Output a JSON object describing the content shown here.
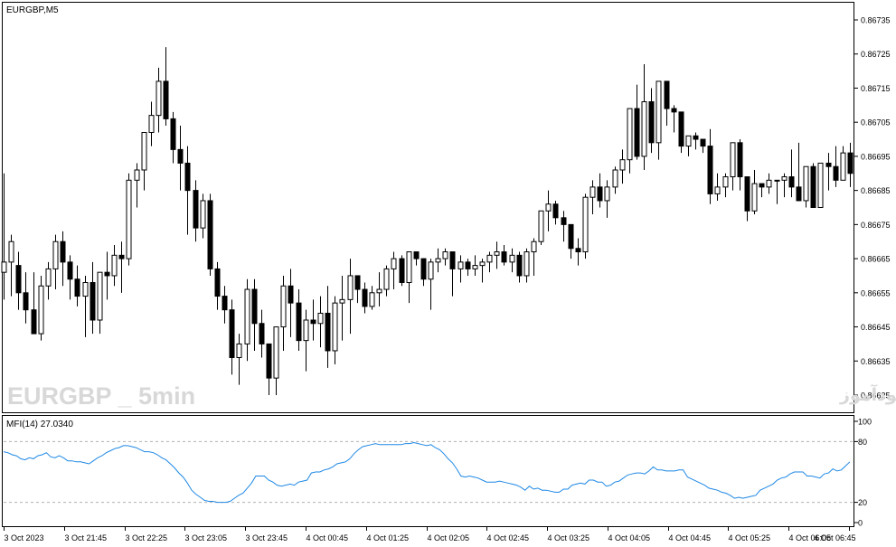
{
  "colors": {
    "background": "#ffffff",
    "foreground": "#000000",
    "bull_candle_fill": "#ffffff",
    "bear_candle_fill": "#000000",
    "mfi_line": "#1e88e5",
    "level_line": "#b0b0b0",
    "watermark": "#d8d8d8"
  },
  "main_panel": {
    "symbol_label": "EURGBP,M5",
    "watermark_left": "EURGBP _ 5min",
    "watermark_right": "انتشار در سایت سودآموز"
  },
  "indicator_panel": {
    "label": "MFI(14) 27.0340",
    "levels": [
      80,
      20
    ]
  },
  "chart_data": [
    {
      "type": "candlestick",
      "title": "EURGBP,M5",
      "ylim": [
        0.86618,
        0.86738
      ],
      "y_ticks": [
        "0.86735",
        "0.86725",
        "0.86715",
        "0.86705",
        "0.86695",
        "0.86685",
        "0.86675",
        "0.86665",
        "0.86655",
        "0.86645",
        "0.86635",
        "0.86625"
      ],
      "x_tick_labels": [
        "3 Oct 2023",
        "3 Oct 21:45",
        "3 Oct 22:25",
        "3 Oct 23:05",
        "3 Oct 23:45",
        "4 Oct 00:45",
        "4 Oct 01:25",
        "4 Oct 02:05",
        "4 Oct 02:45",
        "4 Oct 03:25",
        "4 Oct 04:05",
        "4 Oct 04:45",
        "4 Oct 05:25",
        "4 Oct 06:05",
        "4 Oct 06:45"
      ],
      "candles": [
        [
          0.86661,
          0.8669,
          0.86653,
          0.86664
        ],
        [
          0.86664,
          0.86672,
          0.86654,
          0.8667
        ],
        [
          0.86663,
          0.86667,
          0.8665,
          0.86655
        ],
        [
          0.86655,
          0.86661,
          0.86646,
          0.8665
        ],
        [
          0.8665,
          0.86661,
          0.86645,
          0.86643
        ],
        [
          0.86643,
          0.8666,
          0.86641,
          0.86657
        ],
        [
          0.86657,
          0.86664,
          0.86653,
          0.86662
        ],
        [
          0.86662,
          0.86672,
          0.86656,
          0.8667
        ],
        [
          0.8667,
          0.86673,
          0.86657,
          0.86664
        ],
        [
          0.86664,
          0.86666,
          0.86653,
          0.86659
        ],
        [
          0.86659,
          0.86663,
          0.86651,
          0.86654
        ],
        [
          0.86654,
          0.8666,
          0.86642,
          0.86658
        ],
        [
          0.86658,
          0.86664,
          0.86643,
          0.86647
        ],
        [
          0.86647,
          0.86661,
          0.86643,
          0.86661
        ],
        [
          0.86661,
          0.86667,
          0.86653,
          0.8666
        ],
        [
          0.8666,
          0.86669,
          0.86657,
          0.86666
        ],
        [
          0.86666,
          0.8667,
          0.86655,
          0.86665
        ],
        [
          0.86665,
          0.8669,
          0.86663,
          0.86688
        ],
        [
          0.86688,
          0.86693,
          0.8668,
          0.86691
        ],
        [
          0.86691,
          0.86702,
          0.86685,
          0.86702
        ],
        [
          0.86702,
          0.86711,
          0.86698,
          0.86707
        ],
        [
          0.86707,
          0.86721,
          0.86702,
          0.86717
        ],
        [
          0.86717,
          0.86727,
          0.86704,
          0.86706
        ],
        [
          0.86706,
          0.86708,
          0.86693,
          0.86697
        ],
        [
          0.86697,
          0.86704,
          0.86685,
          0.86693
        ],
        [
          0.86693,
          0.86698,
          0.86672,
          0.86685
        ],
        [
          0.86685,
          0.86688,
          0.8667,
          0.86674
        ],
        [
          0.86674,
          0.86684,
          0.86671,
          0.86682
        ],
        [
          0.86682,
          0.86684,
          0.8666,
          0.86662
        ],
        [
          0.86662,
          0.86664,
          0.8665,
          0.86654
        ],
        [
          0.86654,
          0.86657,
          0.86646,
          0.8665
        ],
        [
          0.8665,
          0.86653,
          0.86631,
          0.86636
        ],
        [
          0.86636,
          0.86643,
          0.86628,
          0.8664
        ],
        [
          0.8664,
          0.86659,
          0.86635,
          0.86656
        ],
        [
          0.86656,
          0.86659,
          0.86638,
          0.86646
        ],
        [
          0.86646,
          0.8665,
          0.86636,
          0.8664
        ],
        [
          0.8664,
          0.86637,
          0.86625,
          0.8663
        ],
        [
          0.8663,
          0.86642,
          0.86625,
          0.86645
        ],
        [
          0.86645,
          0.8666,
          0.86638,
          0.86657
        ],
        [
          0.86657,
          0.86662,
          0.86642,
          0.86652
        ],
        [
          0.86652,
          0.86656,
          0.86638,
          0.86641
        ],
        [
          0.86641,
          0.8665,
          0.86632,
          0.86647
        ],
        [
          0.86647,
          0.86653,
          0.86641,
          0.86646
        ],
        [
          0.86646,
          0.86654,
          0.86639,
          0.86649
        ],
        [
          0.86649,
          0.86657,
          0.86633,
          0.86638
        ],
        [
          0.86638,
          0.86654,
          0.86634,
          0.86652
        ],
        [
          0.86652,
          0.8666,
          0.86641,
          0.86653
        ],
        [
          0.86653,
          0.86665,
          0.86643,
          0.8666
        ],
        [
          0.8666,
          0.8666,
          0.86652,
          0.86656
        ],
        [
          0.86656,
          0.86658,
          0.86649,
          0.86651
        ],
        [
          0.86651,
          0.86657,
          0.8665,
          0.86655
        ],
        [
          0.86655,
          0.86661,
          0.86651,
          0.86656
        ],
        [
          0.86656,
          0.86663,
          0.86654,
          0.86662
        ],
        [
          0.86662,
          0.86667,
          0.86656,
          0.86665
        ],
        [
          0.86665,
          0.86666,
          0.86657,
          0.86658
        ],
        [
          0.86658,
          0.86658,
          0.86652,
          0.86667
        ],
        [
          0.86667,
          0.86666,
          0.86663,
          0.86665
        ],
        [
          0.86665,
          0.86663,
          0.86657,
          0.86659
        ],
        [
          0.86659,
          0.86665,
          0.8665,
          0.86664
        ],
        [
          0.86664,
          0.86668,
          0.86661,
          0.86665
        ],
        [
          0.86665,
          0.86668,
          0.86663,
          0.86667
        ],
        [
          0.86667,
          0.86663,
          0.86654,
          0.86662
        ],
        [
          0.86662,
          0.86666,
          0.86658,
          0.86664
        ],
        [
          0.86664,
          0.86665,
          0.8666,
          0.86662
        ],
        [
          0.86662,
          0.86666,
          0.8666,
          0.86663
        ],
        [
          0.86663,
          0.86665,
          0.86658,
          0.86664
        ],
        [
          0.86664,
          0.86667,
          0.86661,
          0.86666
        ],
        [
          0.86666,
          0.8667,
          0.86662,
          0.86667
        ],
        [
          0.86667,
          0.86669,
          0.86663,
          0.86664
        ],
        [
          0.86664,
          0.86668,
          0.86661,
          0.86666
        ],
        [
          0.86666,
          0.86667,
          0.86658,
          0.8666
        ],
        [
          0.8666,
          0.86668,
          0.86658,
          0.86667
        ],
        [
          0.86667,
          0.86671,
          0.8666,
          0.8667
        ],
        [
          0.8667,
          0.86679,
          0.86669,
          0.86679
        ],
        [
          0.86679,
          0.86685,
          0.86673,
          0.86681
        ],
        [
          0.86681,
          0.86682,
          0.86675,
          0.86677
        ],
        [
          0.86677,
          0.86679,
          0.8667,
          0.86675
        ],
        [
          0.86675,
          0.86674,
          0.86665,
          0.86668
        ],
        [
          0.86668,
          0.86671,
          0.86663,
          0.86667
        ],
        [
          0.86667,
          0.86684,
          0.86665,
          0.86683
        ],
        [
          0.86683,
          0.86688,
          0.86678,
          0.86686
        ],
        [
          0.86686,
          0.8669,
          0.8668,
          0.86682
        ],
        [
          0.86682,
          0.86688,
          0.86677,
          0.86686
        ],
        [
          0.86686,
          0.86692,
          0.86684,
          0.86691
        ],
        [
          0.86691,
          0.86697,
          0.86687,
          0.86694
        ],
        [
          0.86694,
          0.86709,
          0.8669,
          0.86709
        ],
        [
          0.86709,
          0.86716,
          0.86694,
          0.86695
        ],
        [
          0.86695,
          0.86722,
          0.86691,
          0.86711
        ],
        [
          0.86711,
          0.86715,
          0.86696,
          0.86699
        ],
        [
          0.86699,
          0.86712,
          0.86694,
          0.86717
        ],
        [
          0.86717,
          0.86716,
          0.86704,
          0.86709
        ],
        [
          0.86709,
          0.8671,
          0.86702,
          0.86708
        ],
        [
          0.86708,
          0.86707,
          0.86696,
          0.86698
        ],
        [
          0.86698,
          0.86701,
          0.86695,
          0.86701
        ],
        [
          0.86701,
          0.86702,
          0.86697,
          0.867
        ],
        [
          0.867,
          0.86699,
          0.86696,
          0.86698
        ],
        [
          0.86698,
          0.86703,
          0.86681,
          0.86684
        ],
        [
          0.86684,
          0.8669,
          0.86682,
          0.86686
        ],
        [
          0.86686,
          0.8669,
          0.86683,
          0.86689
        ],
        [
          0.86689,
          0.86699,
          0.86685,
          0.86699
        ],
        [
          0.86699,
          0.867,
          0.86685,
          0.86689
        ],
        [
          0.86689,
          0.86689,
          0.86676,
          0.86679
        ],
        [
          0.86679,
          0.86691,
          0.86678,
          0.86687
        ],
        [
          0.86687,
          0.86687,
          0.86683,
          0.86686
        ],
        [
          0.86686,
          0.8669,
          0.86684,
          0.86688
        ],
        [
          0.86688,
          0.86688,
          0.86681,
          0.86688
        ],
        [
          0.86688,
          0.8669,
          0.86683,
          0.86689
        ],
        [
          0.86689,
          0.86697,
          0.86683,
          0.86686
        ],
        [
          0.86686,
          0.86699,
          0.86682,
          0.86682
        ],
        [
          0.86682,
          0.86692,
          0.8668,
          0.86692
        ],
        [
          0.86692,
          0.86693,
          0.86681,
          0.8668
        ],
        [
          0.8668,
          0.86689,
          0.8668,
          0.86693
        ],
        [
          0.86693,
          0.86696,
          0.86685,
          0.86692
        ],
        [
          0.86692,
          0.86698,
          0.86686,
          0.86688
        ],
        [
          0.86688,
          0.86698,
          0.86688,
          0.86696
        ],
        [
          0.86696,
          0.86699,
          0.86686,
          0.8669
        ]
      ]
    },
    {
      "type": "line",
      "title": "MFI(14) 27.0340",
      "ylim": [
        0,
        100
      ],
      "y_ticks": [
        100,
        80,
        20,
        0
      ],
      "series": [
        {
          "name": "MFI(14)",
          "values": [
            70,
            69,
            67,
            66,
            63,
            62,
            64,
            63,
            66,
            67,
            69,
            65,
            64,
            66,
            64,
            61,
            61,
            60,
            60,
            59,
            58,
            61,
            64,
            66,
            69,
            71,
            73,
            74,
            76,
            76,
            75,
            74,
            72,
            70,
            70,
            69,
            67,
            64,
            62,
            58,
            54,
            49,
            45,
            39,
            32,
            28,
            25,
            22,
            21,
            21,
            20,
            20,
            20,
            21,
            24,
            27,
            29,
            34,
            39,
            46,
            46,
            46,
            42,
            40,
            37,
            36,
            37,
            38,
            37,
            40,
            41,
            42,
            49,
            50,
            50,
            52,
            53,
            55,
            58,
            59,
            60,
            63,
            68,
            72,
            75,
            76,
            77,
            78,
            77,
            77,
            77,
            77,
            77,
            77,
            78,
            78,
            79,
            78,
            77,
            76,
            77,
            74,
            72,
            68,
            63,
            59,
            53,
            46,
            45,
            46,
            45,
            44,
            42,
            40,
            40,
            40,
            41,
            40,
            39,
            38,
            37,
            35,
            32,
            36,
            33,
            34,
            32,
            32,
            31,
            30,
            30,
            33,
            33,
            37,
            38,
            39,
            38,
            42,
            42,
            40,
            40,
            36,
            37,
            40,
            41,
            44,
            47,
            48,
            49,
            49,
            48,
            51,
            55,
            52,
            52,
            51,
            51,
            51,
            52,
            52,
            45,
            43,
            41,
            39,
            37,
            34,
            33,
            32,
            30,
            29,
            27,
            24,
            25,
            24,
            25,
            26,
            27,
            32,
            34,
            36,
            38,
            42,
            44,
            45,
            48,
            50,
            50,
            50,
            46,
            46,
            45,
            44,
            48,
            49,
            53,
            51,
            52,
            56,
            60
          ]
        }
      ]
    }
  ]
}
